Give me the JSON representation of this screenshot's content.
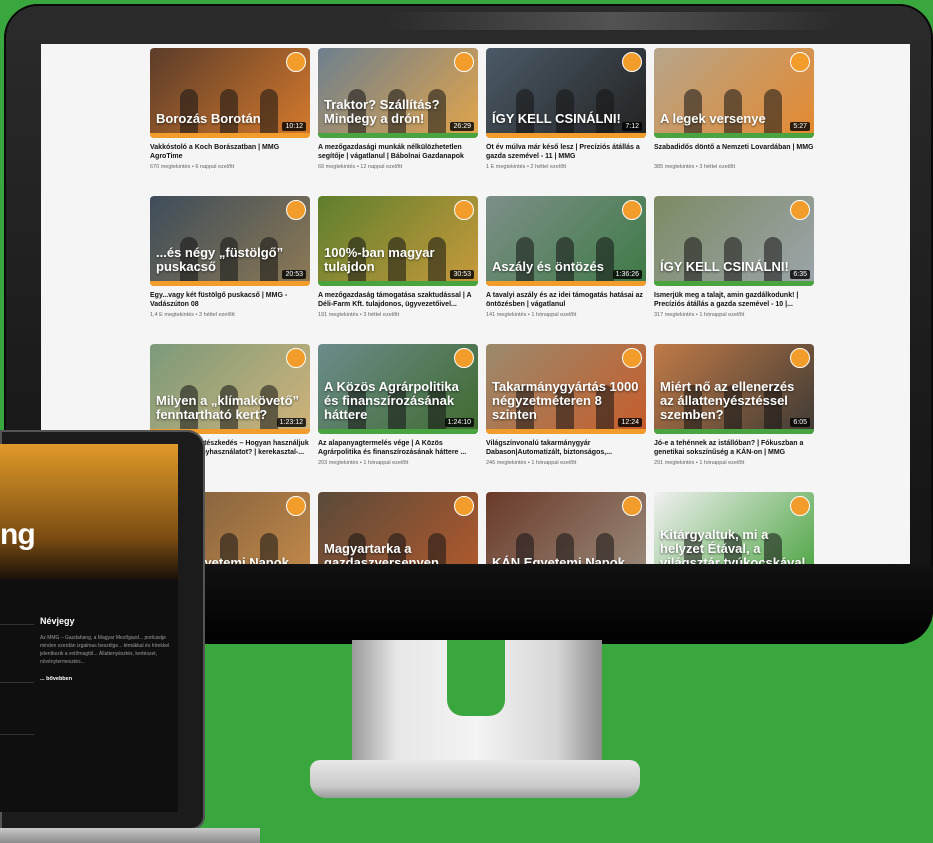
{
  "videos": [
    {
      "title": "Vakkóstoló a Koch Borászatban | MMG AgroTime",
      "meta": "670 megtekintés • 6 nappal ezelőtt",
      "duration": "10:12",
      "overlay": "Borozás Borotán",
      "colors": [
        "#5b3c2a",
        "#d67a2c"
      ]
    },
    {
      "title": "A mezőgazdasági munkák nélkülözhetetlen segítője | vágatlanul | Bábolnai Gazdanapok",
      "meta": "69 megtekintés • 12 nappal ezelőtt",
      "duration": "26:29",
      "overlay": "Traktor? Szállítás? Mindegy a drón!",
      "colors": [
        "#6d7f8f",
        "#e3a54a"
      ]
    },
    {
      "title": "Öt év múlva már késő lesz | Precíziós átállás a gazda szemével - 11 | MMG",
      "meta": "1 E megtekintés • 2 héttel ezelőtt",
      "duration": "7:12",
      "overlay": "ÍGY KELL CSINÁLNI!",
      "colors": [
        "#4b5a67",
        "#222"
      ]
    },
    {
      "title": "Szabadidős döntő a Nemzeti Lovardában | MMG",
      "meta": "385 megtekintés • 3 héttel ezelőtt",
      "duration": "5:27",
      "overlay": "A legek versenye",
      "colors": [
        "#b6a58a",
        "#e5892f"
      ]
    },
    {
      "title": "Egy...vagy két füstölgő puskacső | MMG - Vadászúton 08",
      "meta": "1,4 E megtekintés • 3 héttel ezelőtt",
      "duration": "20:53",
      "overlay": "...és négy „füstölgő” puskacső",
      "colors": [
        "#3e4c5a",
        "#8d7a55"
      ]
    },
    {
      "title": "A mezőgazdaság támogatása szaktudással | A Déli-Farm Kft. tulajdonos, ügyvezetőivel...",
      "meta": "191 megtekintés • 3 héttel ezelőtt",
      "duration": "30:53",
      "overlay": "100%-ban magyar tulajdon",
      "colors": [
        "#5e7f2e",
        "#c99a3b"
      ]
    },
    {
      "title": "A tavalyi aszály és az idei támogatás hatásai az öntözésben | vágatlanul",
      "meta": "141 megtekintés • 1 hónappal ezelőtt",
      "duration": "1:36:26",
      "overlay": "Aszály és öntözés",
      "colors": [
        "#7d8f88",
        "#3e7a46"
      ]
    },
    {
      "title": "Ismerjük meg a talajt, amin gazdálkodunk! | Precíziós átállás a gazda szemével - 10 |...",
      "meta": "317 megtekintés • 1 hónappal ezelőtt",
      "duration": "6:35",
      "overlay": "ÍGY KELL CSINÁLNI!",
      "colors": [
        "#7c8a63",
        "#9da5ac"
      ]
    },
    {
      "title": "Klímakövető kertészkedés – Hogyan használjuk a kertünkben a nyhasználatot? | kerekasztal-...",
      "meta": "1 hónappal ezelőtt",
      "duration": "1:23:12",
      "overlay": "Milyen a „klímakövető” fenntartható kert?",
      "colors": [
        "#7b9a7a",
        "#d1b37a"
      ]
    },
    {
      "title": "Az alapanyagtermelés vége | A Közös Agrárpolitika és finanszírozásának háttere ...",
      "meta": "203 megtekintés • 1 hónappal ezelőtt",
      "duration": "1:24:10",
      "overlay": "A Közös Agrárpolitika és finanszírozásának háttere",
      "colors": [
        "#6b8c8b",
        "#3f6a2f"
      ]
    },
    {
      "title": "Világszínvonalú takarmánygyár Dabason|Automatizált, biztonságos,...",
      "meta": "246 megtekintés • 1 hónappal ezelőtt",
      "duration": "12:24",
      "overlay": "Takarmánygyártás 1000 négyzetméteren 8 szinten",
      "colors": [
        "#9b8a6d",
        "#c65c2a"
      ]
    },
    {
      "title": "Jó-e a tehénnek az istállóban? | Fókuszban a genetikai sokszínűség a KÁN-on | MMG",
      "meta": "291 megtekintés • 1 hónappal ezelőtt",
      "duration": "6:05",
      "overlay": "Miért nő az ellenerzés az állattenyésztéssel szemben?",
      "colors": [
        "#c07a47",
        "#3e3a35"
      ]
    },
    {
      "title": "",
      "meta": "",
      "duration": "",
      "overlay": "KÁN Egyetemi Napok",
      "colors": [
        "#7a5b3c",
        "#c38a4a"
      ]
    },
    {
      "title": "",
      "meta": "",
      "duration": "",
      "overlay": "Magyartarka a gazdaszversenyen",
      "colors": [
        "#5a4a3a",
        "#b35a2d"
      ]
    },
    {
      "title": "",
      "meta": "",
      "duration": "",
      "overlay": "KÁN Egyetemi Napok",
      "colors": [
        "#6a3a2a",
        "#9c8c7c"
      ]
    },
    {
      "title": "",
      "meta": "",
      "duration": "",
      "overlay": "Kitárgyaltuk, mi a helyzet Étával, a világsztár tyúkocskával",
      "colors": [
        "#f0f0f0",
        "#49a33f"
      ]
    }
  ],
  "laptop": {
    "banner_text": "ng",
    "about_title": "Névjegy",
    "about_text": "Az MMG – Gazdahang, a Magyar Mezőgazd... podcastje minden szerdán izgalmas beszélge... témákkal és hírekkel jelentkezik a vetőmagtól... Állattenyésztés, kertészet, növénytermesztés...",
    "about_more": "... bővebben"
  }
}
